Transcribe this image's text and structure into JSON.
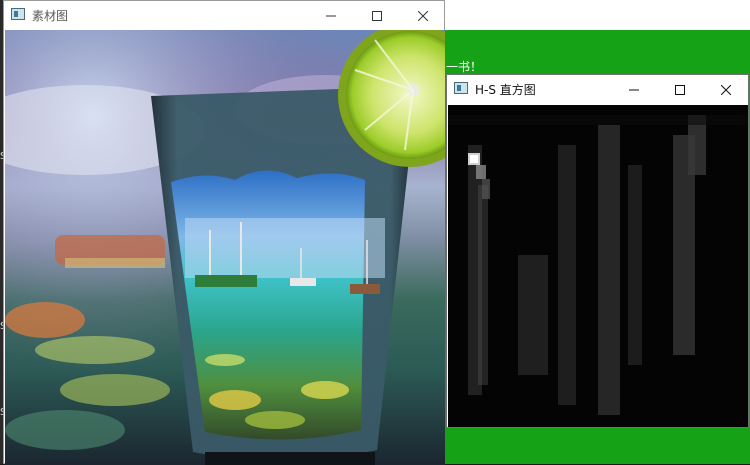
{
  "background_window": {
    "text": "一书！",
    "color": "#16a216"
  },
  "edge_letters": [
    "S",
    "S",
    "S"
  ],
  "image_window": {
    "title": "素材图",
    "controls": {
      "minimize": "—",
      "maximize": "☐",
      "close": "✕"
    }
  },
  "hs_window": {
    "title": "H-S 直方图",
    "controls": {
      "minimize": "—",
      "maximize": "☐",
      "close": "✕"
    }
  }
}
